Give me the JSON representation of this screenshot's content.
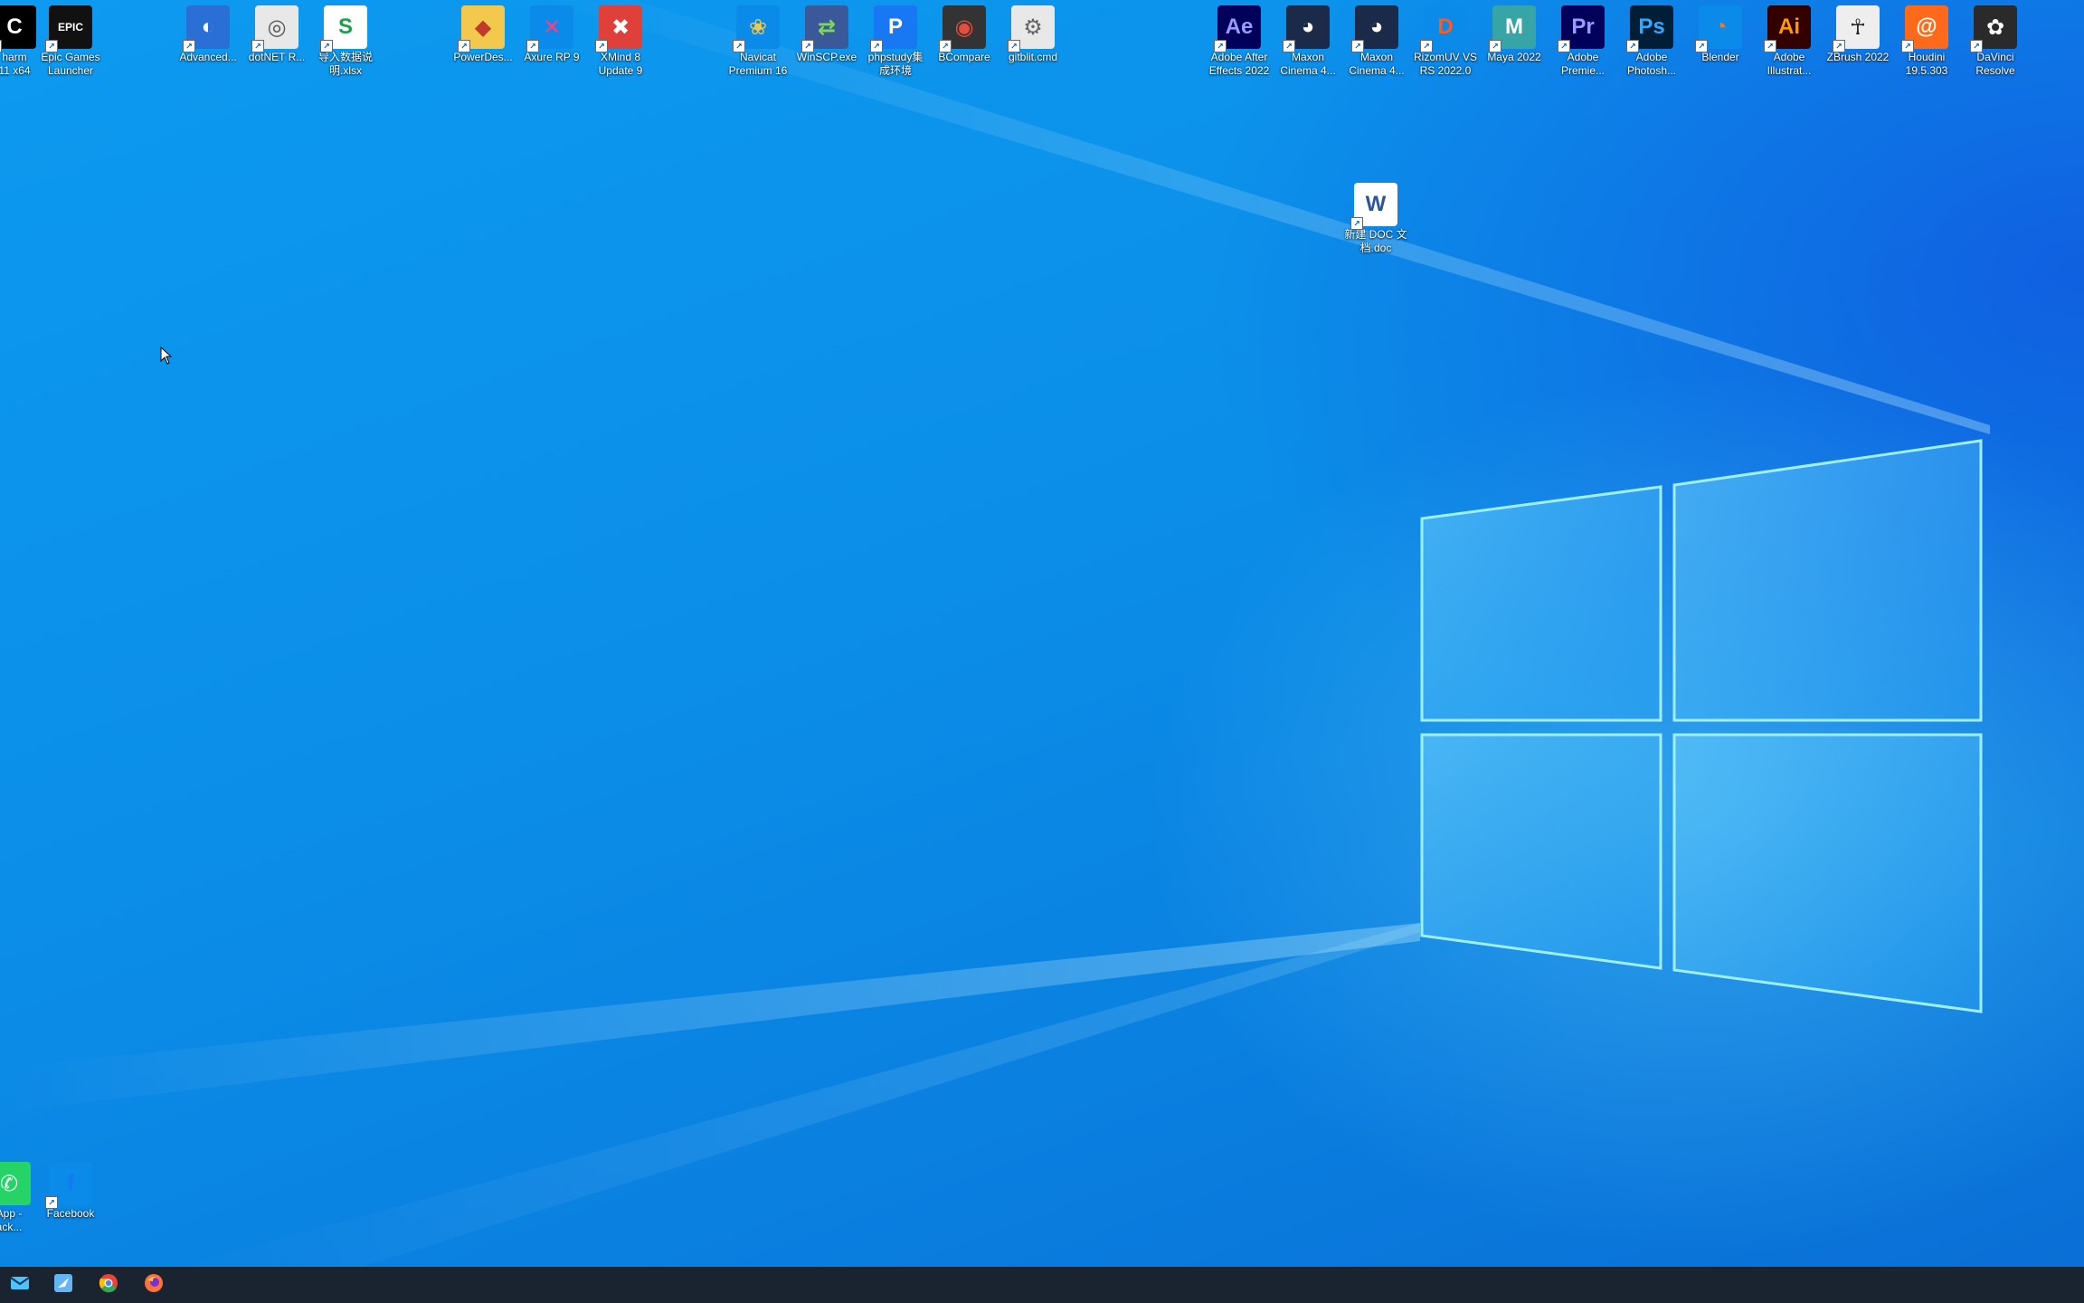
{
  "desktop": {
    "icons_top": [
      {
        "label": "harm\n11 x64",
        "icon": "jetbrains-icon",
        "bg": "#000000",
        "fg": "#ffffff",
        "text": "C"
      },
      {
        "label": "Epic Games\nLauncher",
        "icon": "epic-games-icon",
        "bg": "#111111",
        "fg": "#ffffff",
        "text": "EPIC"
      },
      {
        "label": "Advanced...",
        "icon": "advanced-installer-icon",
        "bg": "#2a6fd6",
        "fg": "#ffffff",
        "text": "◐"
      },
      {
        "label": "dotNET R...",
        "icon": "dotnet-reactor-icon",
        "bg": "#e8e8e8",
        "fg": "#555555",
        "text": "◎"
      },
      {
        "label": "导入数据说\n明.xlsx",
        "icon": "spreadsheet-file-icon",
        "bg": "#ffffff",
        "fg": "#1e9e4a",
        "text": "S"
      },
      {
        "label": "PowerDes...",
        "icon": "powerdesigner-icon",
        "bg": "#f2c94c",
        "fg": "#c0392b",
        "text": "◆"
      },
      {
        "label": "Axure RP 9",
        "icon": "axure-icon",
        "bg": "#0a8bea",
        "fg": "#ff3d7f",
        "text": "✕"
      },
      {
        "label": "XMind 8\nUpdate 9",
        "icon": "xmind-icon",
        "bg": "#e0403a",
        "fg": "#ffffff",
        "text": "✖"
      },
      {
        "label": "Navicat\nPremium 16",
        "icon": "navicat-icon",
        "bg": "#0a8bea",
        "fg": "#f2c94c",
        "text": "❀"
      },
      {
        "label": "WinSCP.exe",
        "icon": "winscp-icon",
        "bg": "#3b5998",
        "fg": "#7ed957",
        "text": "⇄"
      },
      {
        "label": "phpstudy集\n成环境",
        "icon": "phpstudy-icon",
        "bg": "#1877f2",
        "fg": "#ffffff",
        "text": "P"
      },
      {
        "label": "BCompare",
        "icon": "beyond-compare-icon",
        "bg": "#333333",
        "fg": "#e74c3c",
        "text": "◉"
      },
      {
        "label": "gitblit.cmd",
        "icon": "cmd-file-icon",
        "bg": "#e8e8e8",
        "fg": "#666666",
        "text": "⚙"
      },
      {
        "label": "Adobe After\nEffects 2022",
        "icon": "after-effects-icon",
        "bg": "#00005b",
        "fg": "#9999ff",
        "text": "Ae"
      },
      {
        "label": "Maxon\nCinema 4...",
        "icon": "cinema4d-icon",
        "bg": "#1c2a4a",
        "fg": "#ffffff",
        "text": "◕"
      },
      {
        "label": "Maxon\nCinema 4...",
        "icon": "cinema4d-icon-2",
        "bg": "#1c2a4a",
        "fg": "#ffffff",
        "text": "◕"
      },
      {
        "label": "RizomUV VS\nRS 2022.0",
        "icon": "rizomuv-icon",
        "bg": "#0a8bea",
        "fg": "#ff5a1f",
        "text": "D"
      },
      {
        "label": "Maya 2022",
        "icon": "maya-icon",
        "bg": "#37a5a5",
        "fg": "#ffffff",
        "text": "M"
      },
      {
        "label": "Adobe\nPremie...",
        "icon": "premiere-icon",
        "bg": "#00005b",
        "fg": "#9999ff",
        "text": "Pr"
      },
      {
        "label": "Adobe\nPhotosh...",
        "icon": "photoshop-icon",
        "bg": "#001e36",
        "fg": "#31a8ff",
        "text": "Ps"
      },
      {
        "label": "Blender",
        "icon": "blender-icon",
        "bg": "#0a8bea",
        "fg": "#f5792a",
        "text": "◔"
      },
      {
        "label": "Adobe\nIllustrat...",
        "icon": "illustrator-icon",
        "bg": "#330000",
        "fg": "#ff9a00",
        "text": "Ai"
      },
      {
        "label": "ZBrush 2022",
        "icon": "zbrush-icon",
        "bg": "#eeeeee",
        "fg": "#222222",
        "text": "☥"
      },
      {
        "label": "Houdini\n19.5.303",
        "icon": "houdini-icon",
        "bg": "#ff6a1a",
        "fg": "#ffffff",
        "text": "@"
      },
      {
        "label": "DaVinci\nResolve",
        "icon": "davinci-resolve-icon",
        "bg": "#2a2a2a",
        "fg": "#ffffff",
        "text": "✿"
      }
    ],
    "doc_icon": {
      "label": "新建 DOC 文\n档.doc",
      "icon": "word-document-icon",
      "bg": "#ffffff",
      "fg": "#2b579a",
      "text": "W"
    },
    "icons_bottom": [
      {
        "label": "App -\nack...",
        "icon": "whatsapp-icon",
        "bg": "#25d366",
        "fg": "#ffffff",
        "text": "✆"
      },
      {
        "label": "Facebook",
        "icon": "facebook-icon",
        "bg": "#0a8bea",
        "fg": "#1877f2",
        "text": "f"
      }
    ]
  },
  "taskbar": {
    "items": [
      {
        "icon": "mail-icon",
        "color": "#4fc3f7"
      },
      {
        "icon": "feather-icon",
        "color": "#64b5f6"
      },
      {
        "icon": "chrome-icon",
        "color": "#34a853"
      },
      {
        "icon": "firefox-icon",
        "color": "#ff7139"
      }
    ]
  }
}
